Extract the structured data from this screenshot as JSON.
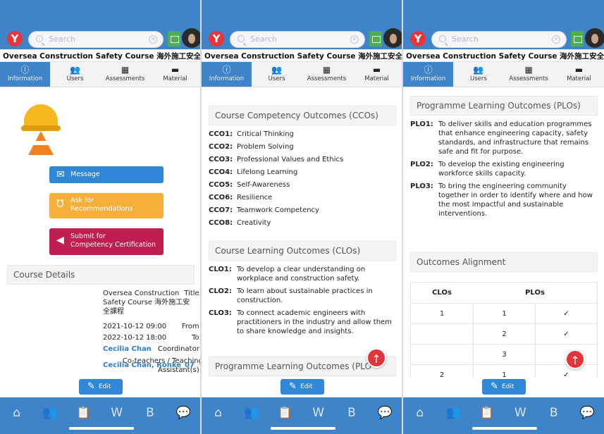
{
  "app": {
    "logo_letter": "Y",
    "search_placeholder": "Search",
    "course_title": "Oversea Construction Safety Course 海外施工安全課程"
  },
  "tabs": [
    {
      "label": "Information",
      "icon": "ⓘ"
    },
    {
      "label": "Users",
      "icon": "👥"
    },
    {
      "label": "Assessments",
      "icon": "▦"
    },
    {
      "label": "Material",
      "icon": "▬"
    }
  ],
  "panel1": {
    "buttons": {
      "message": "Message",
      "ask_line1": "Ask for",
      "ask_line2": "Recommendations",
      "submit_line1": "Submit for",
      "submit_line2": "Competency Certification"
    },
    "course_details_heading": "Course Details",
    "details": {
      "title_label": "Title:",
      "title_line1": "Oversea Construction",
      "title_line2": "Safety Course 海外施工安",
      "title_line3": "全課程",
      "from_label": "From:",
      "from_value": "2021-10-12 09:00",
      "to_label": "To:",
      "to_value": "2022-10-12 18:00",
      "coordinator_label": "Coordinator:",
      "coordinator_value": "Cecilia Chan",
      "coteachers_label_line1": "Co-teachers / Teaching",
      "coteachers_label_line2": "Assistant(s):",
      "coteachers_value": "Cecilia Chan, Ronke_07"
    }
  },
  "panel2": {
    "cco_heading": "Course Competency Outcomes (CCOs)",
    "ccos": [
      {
        "code": "CCO1:",
        "text": "Critical Thinking"
      },
      {
        "code": "CCO2:",
        "text": "Problem Solving"
      },
      {
        "code": "CCO3:",
        "text": "Professional Values and Ethics"
      },
      {
        "code": "CCO4:",
        "text": "Lifelong Learning"
      },
      {
        "code": "CCO5:",
        "text": "Self-Awareness"
      },
      {
        "code": "CCO6:",
        "text": "Resilience"
      },
      {
        "code": "CCO7:",
        "text": "Teamwork Competency"
      },
      {
        "code": "CCO8:",
        "text": "Creativity"
      }
    ],
    "clo_heading": "Course Learning Outcomes (CLOs)",
    "clos": [
      {
        "code": "CLO1:",
        "text": "To develop a clear understanding on workplace and construction safety."
      },
      {
        "code": "CLO2:",
        "text": "To learn about sustainable practices in construction."
      },
      {
        "code": "CLO3:",
        "text": "To connect academic engineers with practitioners in the industry and allow them to share knowledge and insights."
      }
    ],
    "plo_heading_partial": "Programme Learning Outcomes (PLO"
  },
  "panel3": {
    "plo_heading": "Programme Learning Outcomes (PLOs)",
    "plos": [
      {
        "code": "PLO1:",
        "text": "To deliver skills and education programmes that enhance engineering capacity, safety standards, and infrastructure that remains safe and fit for purpose."
      },
      {
        "code": "PLO2:",
        "text": "To develop the existing engineering workforce skills capacity."
      },
      {
        "code": "PLO3:",
        "text": "To bring the engineering community together in order to identify where and how the most impactful and sustainable interventions."
      }
    ],
    "alignment_heading": "Outcomes Alignment",
    "alignment_table": {
      "col1": "CLOs",
      "col2": "PLOs",
      "rows": [
        {
          "clo": "1",
          "plo": "1",
          "check": "✓"
        },
        {
          "clo": "",
          "plo": "2",
          "check": "✓"
        },
        {
          "clo": "",
          "plo": "3",
          "check": ""
        },
        {
          "clo": "2",
          "plo": "1",
          "check": "✓"
        }
      ]
    }
  },
  "edit_label": "Edit",
  "bottom_nav": [
    {
      "name": "home-icon",
      "glyph": "⌂"
    },
    {
      "name": "users-icon",
      "glyph": "👥"
    },
    {
      "name": "clipboard-icon",
      "glyph": "📋"
    },
    {
      "name": "wiki-icon",
      "glyph": "W"
    },
    {
      "name": "blog-icon",
      "glyph": "B"
    },
    {
      "name": "chat-icon",
      "glyph": "💬"
    }
  ],
  "colors": {
    "brand_blue": "#3f84c8",
    "message_blue": "#2f87d5",
    "ask_orange": "#f6b03a",
    "submit_crimson": "#bf1e4e",
    "fab_red": "#e2353a"
  }
}
